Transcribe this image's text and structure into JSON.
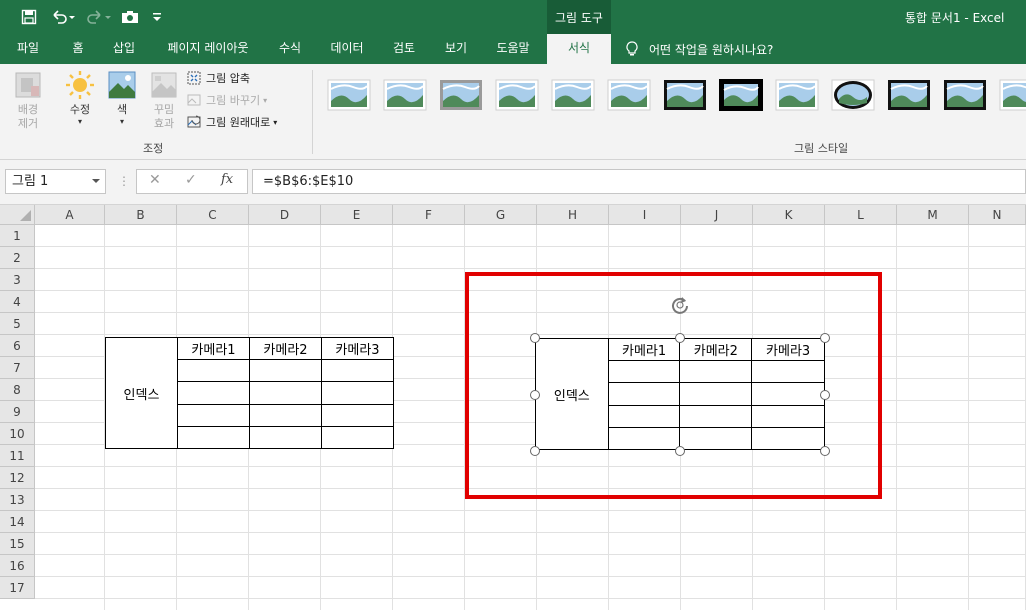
{
  "context_tab": "그림 도구",
  "document_title": "통합 문서1  -  Excel",
  "menu": {
    "tabs": [
      "파일",
      "홈",
      "삽입",
      "페이지 레이아웃",
      "수식",
      "데이터",
      "검토",
      "보기",
      "도움말",
      "서식"
    ],
    "active_tab": "서식",
    "tell_me": "어떤 작업을 원하시나요?"
  },
  "ribbon": {
    "remove_bg": "배경\n제거",
    "corrections": "수정",
    "color": "색",
    "artistic": "꾸밈\n효과",
    "compress": "그림 압축",
    "change_picture": "그림 바꾸기",
    "reset_picture": "그림 원래대로",
    "adjust_group": "조정",
    "styles_group": "그림 스타일"
  },
  "formula_bar": {
    "name_box": "그림 1",
    "fx": "fx",
    "formula": "=$B$6:$E$10"
  },
  "columns": [
    "A",
    "B",
    "C",
    "D",
    "E",
    "F",
    "G",
    "H",
    "I",
    "J",
    "K",
    "L",
    "M",
    "N"
  ],
  "rows": [
    "1",
    "2",
    "3",
    "4",
    "5",
    "6",
    "7",
    "8",
    "9",
    "10",
    "11",
    "12",
    "13",
    "14",
    "15",
    "16",
    "17"
  ],
  "sheet_table": {
    "index_label": "인덱스",
    "headers": [
      "카메라1",
      "카메라2",
      "카메라3"
    ]
  },
  "picture_table": {
    "index_label": "인덱스",
    "headers": [
      "카메라1",
      "카메라2",
      "카메라3"
    ]
  },
  "colors": {
    "excel_green": "#217346",
    "highlight_red": "#e10000"
  }
}
